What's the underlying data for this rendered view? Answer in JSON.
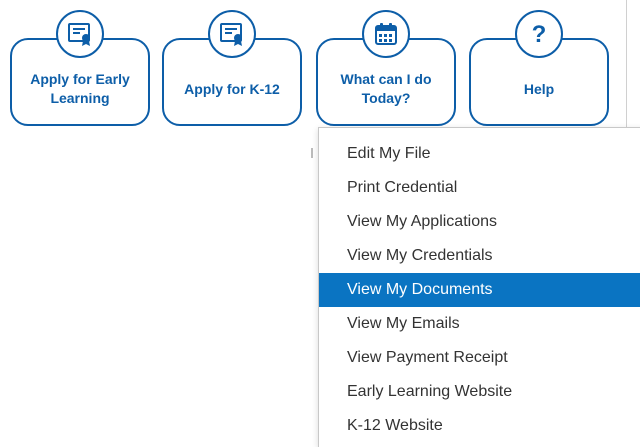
{
  "nav": {
    "tiles": [
      {
        "label": "Apply for Early Learning",
        "icon": "certificate-icon"
      },
      {
        "label": "Apply for K-12",
        "icon": "certificate-icon"
      },
      {
        "label": "What can I do Today?",
        "icon": "calendar-icon"
      },
      {
        "label": "Help",
        "icon": "question-icon"
      }
    ]
  },
  "menu": {
    "active_index": 4,
    "items": [
      {
        "label": "Edit My File"
      },
      {
        "label": "Print Credential"
      },
      {
        "label": "View My Applications"
      },
      {
        "label": "View My Credentials"
      },
      {
        "label": "View My Documents"
      },
      {
        "label": "View My Emails"
      },
      {
        "label": "View Payment Receipt"
      },
      {
        "label": "Early Learning Website"
      },
      {
        "label": "K-12 Website"
      }
    ]
  },
  "colors": {
    "brand_blue": "#0d5ea8",
    "highlight_blue": "#0a74c2",
    "menu_text": "#333333"
  }
}
